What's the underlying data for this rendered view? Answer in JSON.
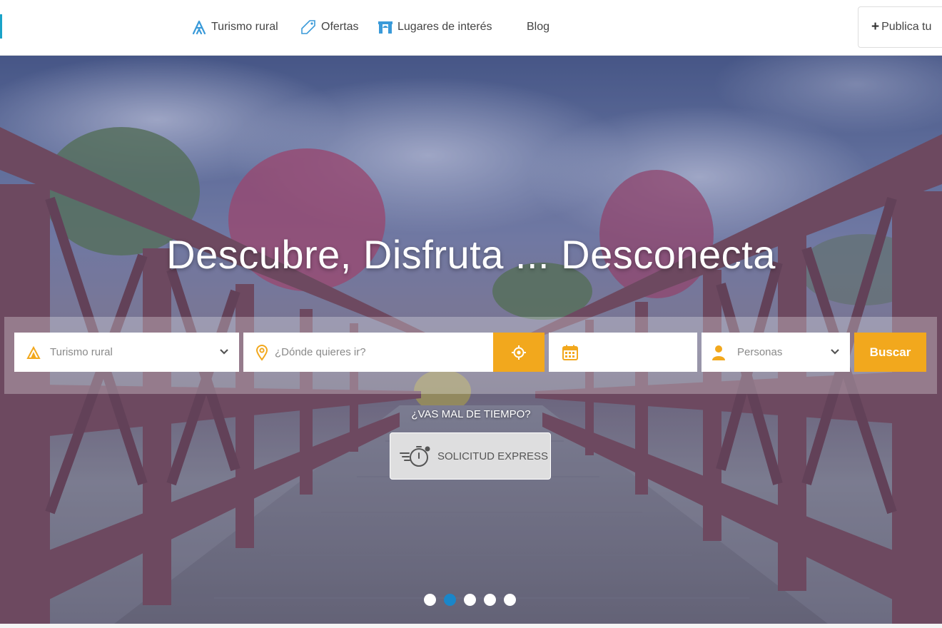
{
  "header": {
    "nav": [
      {
        "label": "Turismo rural",
        "icon": "tent-icon"
      },
      {
        "label": "Ofertas",
        "icon": "tag-icon"
      },
      {
        "label": "Lugares de interés",
        "icon": "landmark-icon"
      },
      {
        "label": "Blog",
        "icon": ""
      }
    ],
    "publish_label": "Publica tu"
  },
  "hero": {
    "title": "Descubre, Disfruta ... Desconecta",
    "search": {
      "type_value": "Turismo rural",
      "destination_placeholder": "¿Dónde quieres ir?",
      "dates_value": "",
      "people_value": "Personas",
      "search_label": "Buscar"
    },
    "weather_question": "¿VAS MAL DE TIEMPO?",
    "express_label": "SOLICITUD EXPRESS",
    "slider": {
      "count": 5,
      "active_index": 1
    }
  },
  "colors": {
    "accent": "#f2a81d",
    "brand_blue": "#1a86c9",
    "nav_icon_blue": "#3a9ad9"
  }
}
